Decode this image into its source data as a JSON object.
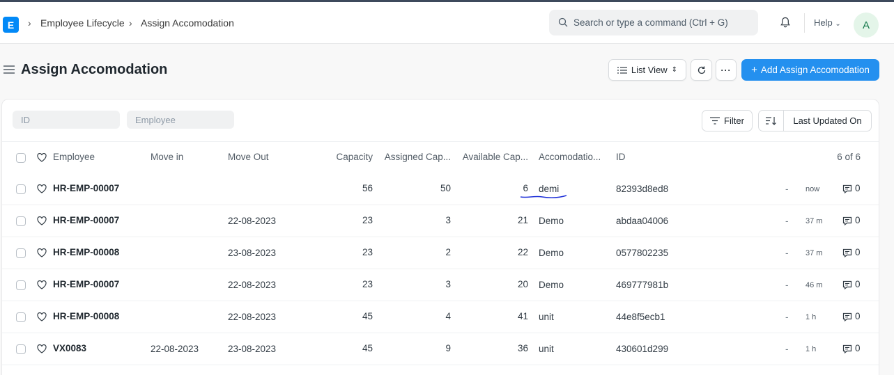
{
  "app": {
    "logo_letter": "E",
    "accent": "#2490ef"
  },
  "breadcrumb": [
    "Employee Lifecycle",
    "Assign Accomodation"
  ],
  "search": {
    "placeholder": "Search or type a command (Ctrl + G)"
  },
  "help": {
    "label": "Help"
  },
  "user": {
    "avatar_letter": "A"
  },
  "page": {
    "title": "Assign Accomodation"
  },
  "toolbar": {
    "list_view_label": "List View",
    "add_label": "Add Assign Accomodation"
  },
  "filters": {
    "id_placeholder": "ID",
    "employee_placeholder": "Employee",
    "filter_label": "Filter",
    "sort_label": "Last Updated On"
  },
  "table": {
    "headers": {
      "employee": "Employee",
      "move_in": "Move in",
      "move_out": "Move Out",
      "capacity": "Capacity",
      "assigned": "Assigned Cap...",
      "available": "Available Cap...",
      "accomodation": "Accomodatio...",
      "id": "ID",
      "count": "6 of 6"
    },
    "rows": [
      {
        "employee": "HR-EMP-00007",
        "move_in": "",
        "move_out": "",
        "capacity": "56",
        "assigned": "50",
        "available": "6",
        "accomodation": "demi",
        "id": "82393d8ed8",
        "dash": "-",
        "time": "now",
        "comments": "0"
      },
      {
        "employee": "HR-EMP-00007",
        "move_in": "",
        "move_out": "22-08-2023",
        "capacity": "23",
        "assigned": "3",
        "available": "21",
        "accomodation": "Demo",
        "id": "abdaa04006",
        "dash": "-",
        "time": "37 m",
        "comments": "0"
      },
      {
        "employee": "HR-EMP-00008",
        "move_in": "",
        "move_out": "23-08-2023",
        "capacity": "23",
        "assigned": "2",
        "available": "22",
        "accomodation": "Demo",
        "id": "0577802235",
        "dash": "-",
        "time": "37 m",
        "comments": "0"
      },
      {
        "employee": "HR-EMP-00007",
        "move_in": "",
        "move_out": "22-08-2023",
        "capacity": "23",
        "assigned": "3",
        "available": "20",
        "accomodation": "Demo",
        "id": "469777981b",
        "dash": "-",
        "time": "46 m",
        "comments": "0"
      },
      {
        "employee": "HR-EMP-00008",
        "move_in": "",
        "move_out": "22-08-2023",
        "capacity": "45",
        "assigned": "4",
        "available": "41",
        "accomodation": "unit",
        "id": "44e8f5ecb1",
        "dash": "-",
        "time": "1 h",
        "comments": "0"
      },
      {
        "employee": "VX0083",
        "move_in": "22-08-2023",
        "move_out": "23-08-2023",
        "capacity": "45",
        "assigned": "9",
        "available": "36",
        "accomodation": "unit",
        "id": "430601d299",
        "dash": "-",
        "time": "1 h",
        "comments": "0"
      }
    ]
  }
}
